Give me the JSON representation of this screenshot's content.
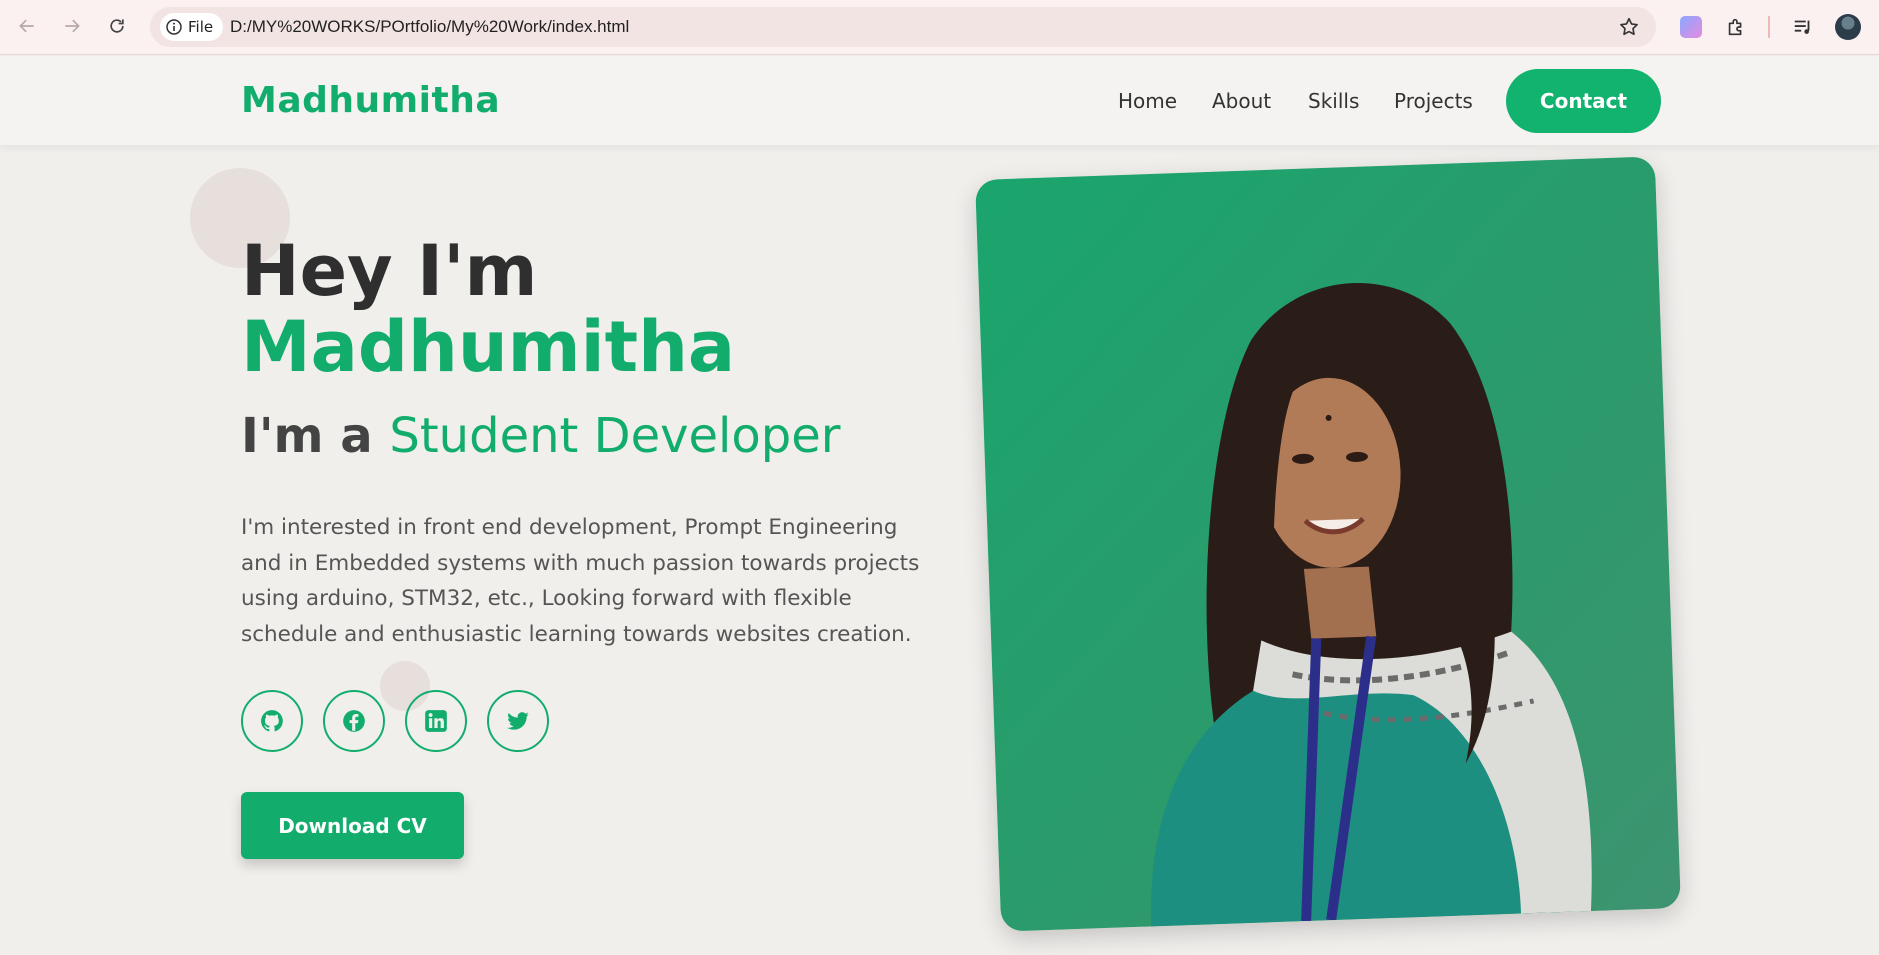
{
  "browser": {
    "file_chip_label": "File",
    "url": "D:/MY%20WORKS/POrtfolio/My%20Work/index.html",
    "icons": [
      "back-icon",
      "forward-icon",
      "reload-icon",
      "info-icon",
      "star-icon",
      "extension-icon",
      "puzzle-icon",
      "media-icon",
      "profile-avatar"
    ]
  },
  "header": {
    "logo": "Madhumitha",
    "nav": [
      "Home",
      "About",
      "Skills",
      "Projects"
    ],
    "contact_label": "Contact"
  },
  "hero": {
    "greeting": "Hey I'm",
    "name": "Madhumitha",
    "role_prefix": "I'm a",
    "role_accent": "Student Developer",
    "description": "I'm interested in front end development, Prompt Engineering and in Embedded systems with much passion towards projects using arduino, STM32, etc., Looking forward with flexible schedule and enthusiastic learning towards websites creation.",
    "social_icons": [
      "github-icon",
      "facebook-icon",
      "linkedin-icon",
      "twitter-icon"
    ],
    "cv_label": "Download CV"
  },
  "colors": {
    "accent": "#12ad6d",
    "text_dark": "#2f2f2f",
    "page_bg": "#f1efec"
  }
}
